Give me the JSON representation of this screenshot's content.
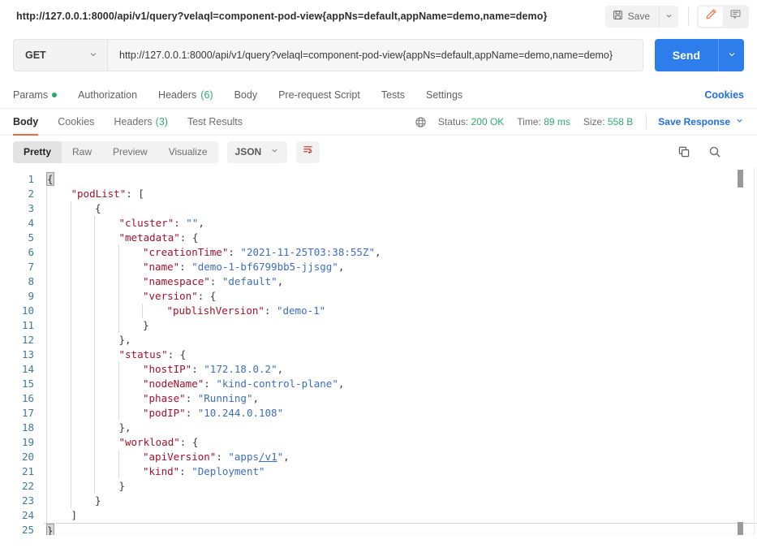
{
  "titlebar": {
    "url_title": "http://127.0.0.1:8000/api/v1/query?velaql=component-pod-view{appNs=default,appName=demo,name=demo}",
    "save_label": "Save",
    "save_caret": "⌄"
  },
  "request": {
    "method": "GET",
    "method_caret": "⌄",
    "url": "http://127.0.0.1:8000/api/v1/query?velaql=component-pod-view{appNs=default,appName=demo,name=demo}",
    "send_label": "Send",
    "send_caret": "⌄"
  },
  "request_tabs": {
    "items": [
      {
        "label": "Params",
        "dot": true
      },
      {
        "label": "Authorization"
      },
      {
        "label": "Headers",
        "count": "(6)"
      },
      {
        "label": "Body"
      },
      {
        "label": "Pre-request Script"
      },
      {
        "label": "Tests"
      },
      {
        "label": "Settings"
      }
    ],
    "cookies_label": "Cookies"
  },
  "response_tabs": {
    "items": [
      {
        "label": "Body",
        "active": true
      },
      {
        "label": "Cookies"
      },
      {
        "label": "Headers",
        "count": "(3)"
      },
      {
        "label": "Test Results"
      }
    ],
    "status_label": "Status:",
    "status_value": "200 OK",
    "time_label": "Time:",
    "time_value": "89 ms",
    "size_label": "Size:",
    "size_value": "558 B",
    "save_response_label": "Save Response",
    "save_response_caret": "⌄"
  },
  "body_toolbar": {
    "views": [
      {
        "label": "Pretty",
        "active": true
      },
      {
        "label": "Raw"
      },
      {
        "label": "Preview"
      },
      {
        "label": "Visualize"
      }
    ],
    "format": "JSON",
    "format_caret": "⌄"
  },
  "colors": {
    "accent_blue": "#2e7ded",
    "active_underline": "#f26b3a",
    "status_green": "#2eab6f",
    "link_blue": "#1f6fe0",
    "json_key": "#a3112a",
    "json_string": "#3c6ec4",
    "line_number": "#3d7b99"
  },
  "code": {
    "lines": [
      {
        "n": "1",
        "indent": 0,
        "tokens": [
          {
            "t": "{",
            "c": "brk"
          }
        ]
      },
      {
        "n": "2",
        "indent": 1,
        "tokens": [
          {
            "t": "\"podList\"",
            "c": "k"
          },
          {
            "t": ": [",
            "c": "p"
          }
        ]
      },
      {
        "n": "3",
        "indent": 2,
        "tokens": [
          {
            "t": "{",
            "c": "p"
          }
        ]
      },
      {
        "n": "4",
        "indent": 3,
        "tokens": [
          {
            "t": "\"cluster\"",
            "c": "k"
          },
          {
            "t": ": ",
            "c": "p"
          },
          {
            "t": "\"\"",
            "c": "s"
          },
          {
            "t": ",",
            "c": "p"
          }
        ]
      },
      {
        "n": "5",
        "indent": 3,
        "tokens": [
          {
            "t": "\"metadata\"",
            "c": "k"
          },
          {
            "t": ": {",
            "c": "p"
          }
        ]
      },
      {
        "n": "6",
        "indent": 4,
        "tokens": [
          {
            "t": "\"creationTime\"",
            "c": "k"
          },
          {
            "t": ": ",
            "c": "p"
          },
          {
            "t": "\"2021-11-25T03:38:55Z\"",
            "c": "s"
          },
          {
            "t": ",",
            "c": "p"
          }
        ]
      },
      {
        "n": "7",
        "indent": 4,
        "tokens": [
          {
            "t": "\"name\"",
            "c": "k"
          },
          {
            "t": ": ",
            "c": "p"
          },
          {
            "t": "\"demo-1-bf6799bb5-jjsgg\"",
            "c": "s"
          },
          {
            "t": ",",
            "c": "p"
          }
        ]
      },
      {
        "n": "8",
        "indent": 4,
        "tokens": [
          {
            "t": "\"namespace\"",
            "c": "k"
          },
          {
            "t": ": ",
            "c": "p"
          },
          {
            "t": "\"default\"",
            "c": "s"
          },
          {
            "t": ",",
            "c": "p"
          }
        ]
      },
      {
        "n": "9",
        "indent": 4,
        "tokens": [
          {
            "t": "\"version\"",
            "c": "k"
          },
          {
            "t": ": {",
            "c": "p"
          }
        ]
      },
      {
        "n": "10",
        "indent": 5,
        "tokens": [
          {
            "t": "\"publishVersion\"",
            "c": "k"
          },
          {
            "t": ": ",
            "c": "p"
          },
          {
            "t": "\"demo-1\"",
            "c": "s"
          }
        ]
      },
      {
        "n": "11",
        "indent": 4,
        "tokens": [
          {
            "t": "}",
            "c": "p"
          }
        ]
      },
      {
        "n": "12",
        "indent": 3,
        "tokens": [
          {
            "t": "},",
            "c": "p"
          }
        ]
      },
      {
        "n": "13",
        "indent": 3,
        "tokens": [
          {
            "t": "\"status\"",
            "c": "k"
          },
          {
            "t": ": {",
            "c": "p"
          }
        ]
      },
      {
        "n": "14",
        "indent": 4,
        "tokens": [
          {
            "t": "\"hostIP\"",
            "c": "k"
          },
          {
            "t": ": ",
            "c": "p"
          },
          {
            "t": "\"172.18.0.2\"",
            "c": "s"
          },
          {
            "t": ",",
            "c": "p"
          }
        ]
      },
      {
        "n": "15",
        "indent": 4,
        "tokens": [
          {
            "t": "\"nodeName\"",
            "c": "k"
          },
          {
            "t": ": ",
            "c": "p"
          },
          {
            "t": "\"kind-control-plane\"",
            "c": "s"
          },
          {
            "t": ",",
            "c": "p"
          }
        ]
      },
      {
        "n": "16",
        "indent": 4,
        "tokens": [
          {
            "t": "\"phase\"",
            "c": "k"
          },
          {
            "t": ": ",
            "c": "p"
          },
          {
            "t": "\"Running\"",
            "c": "s"
          },
          {
            "t": ",",
            "c": "p"
          }
        ]
      },
      {
        "n": "17",
        "indent": 4,
        "tokens": [
          {
            "t": "\"podIP\"",
            "c": "k"
          },
          {
            "t": ": ",
            "c": "p"
          },
          {
            "t": "\"10.244.0.108\"",
            "c": "s"
          }
        ]
      },
      {
        "n": "18",
        "indent": 3,
        "tokens": [
          {
            "t": "},",
            "c": "p"
          }
        ]
      },
      {
        "n": "19",
        "indent": 3,
        "tokens": [
          {
            "t": "\"workload\"",
            "c": "k"
          },
          {
            "t": ": {",
            "c": "p"
          }
        ]
      },
      {
        "n": "20",
        "indent": 4,
        "tokens": [
          {
            "t": "\"apiVersion\"",
            "c": "k"
          },
          {
            "t": ": ",
            "c": "p"
          },
          {
            "t": "\"apps",
            "c": "s"
          },
          {
            "t": "/v1",
            "c": "s ul"
          },
          {
            "t": "\"",
            "c": "s"
          },
          {
            "t": ",",
            "c": "p"
          }
        ]
      },
      {
        "n": "21",
        "indent": 4,
        "tokens": [
          {
            "t": "\"kind\"",
            "c": "k"
          },
          {
            "t": ": ",
            "c": "p"
          },
          {
            "t": "\"Deployment\"",
            "c": "s"
          }
        ]
      },
      {
        "n": "22",
        "indent": 3,
        "tokens": [
          {
            "t": "}",
            "c": "p"
          }
        ]
      },
      {
        "n": "23",
        "indent": 2,
        "tokens": [
          {
            "t": "}",
            "c": "p"
          }
        ]
      },
      {
        "n": "24",
        "indent": 1,
        "tokens": [
          {
            "t": "]",
            "c": "p"
          }
        ]
      },
      {
        "n": "25",
        "indent": 0,
        "current": true,
        "tokens": [
          {
            "t": "}",
            "c": "brk"
          }
        ]
      }
    ]
  }
}
